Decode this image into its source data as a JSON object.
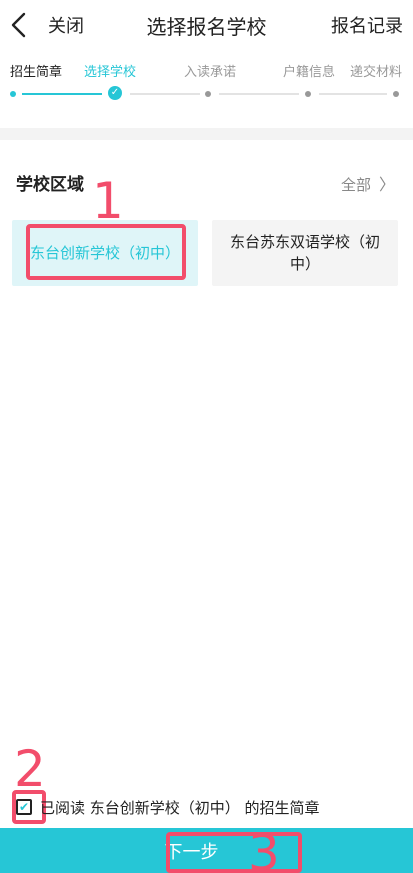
{
  "header": {
    "close_label": "关闭",
    "title": "选择报名学校",
    "history_label": "报名记录"
  },
  "steps": [
    {
      "label": "招生简章",
      "state": "done"
    },
    {
      "label": "选择学校",
      "state": "active"
    },
    {
      "label": "入读承诺",
      "state": "pending"
    },
    {
      "label": "户籍信息",
      "state": "pending"
    },
    {
      "label": "递交材料",
      "state": "pending"
    }
  ],
  "section": {
    "title": "学校区域",
    "all_label": "全部"
  },
  "schools": [
    {
      "name": "东台创新学校（初中）",
      "selected": true
    },
    {
      "name": "东台苏东双语学校（初中）",
      "selected": false
    }
  ],
  "agreement": {
    "checked": true,
    "text": "已阅读 东台创新学校（初中） 的招生简章"
  },
  "next_label": "下一步",
  "annotations": [
    {
      "number": "1"
    },
    {
      "number": "2"
    },
    {
      "number": "3"
    }
  ],
  "colors": {
    "accent": "#26c6d6",
    "annotation": "#f24d6b",
    "selected_bg": "#dff5f8"
  }
}
